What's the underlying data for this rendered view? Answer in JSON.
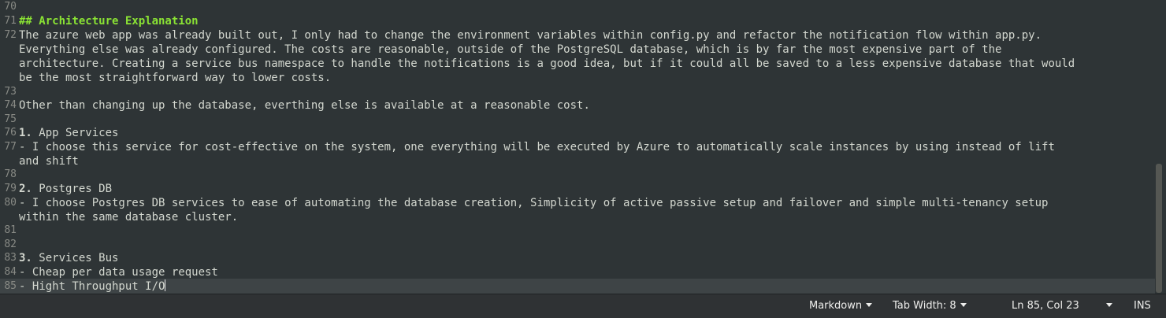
{
  "editor": {
    "lines": [
      {
        "num": "70",
        "text": ""
      },
      {
        "num": "71",
        "text": "## Architecture Explanation"
      },
      {
        "num": "72",
        "text": "The azure web app was already built out, I only had to change the environment variables within config.py and refactor the notification flow within app.py.",
        "wraps": [
          "Everything else was already configured. The costs are reasonable, outside of the PostgreSQL database, which is by far the most expensive part of the",
          "architecture. Creating a service bus namespace to handle the notifications is a good idea, but if it could all be saved to a less expensive database that would",
          "be the most straightforward way to lower costs."
        ]
      },
      {
        "num": "73",
        "text": ""
      },
      {
        "num": "74",
        "text": "Other than changing up the database, everthing else is available at a reasonable cost."
      },
      {
        "num": "75",
        "text": ""
      },
      {
        "num": "76",
        "text_bold": "1.",
        "text": " App Services"
      },
      {
        "num": "77",
        "text": "- I choose this service for cost-effective on the system, one everything will be executed by Azure to automatically scale instances by using instead of lift",
        "wraps": [
          "and shift"
        ]
      },
      {
        "num": "78",
        "text": ""
      },
      {
        "num": "79",
        "text_bold": "2.",
        "text": " Postgres DB"
      },
      {
        "num": "80",
        "text": "- I choose Postgres DB services to ease of automating the database creation, Simplicity of active passive setup and failover and simple multi-tenancy setup",
        "wraps": [
          "within the same database cluster."
        ]
      },
      {
        "num": "81",
        "text": ""
      },
      {
        "num": "82",
        "text": ""
      },
      {
        "num": "83",
        "text_bold": "3.",
        "text": " Services Bus"
      },
      {
        "num": "84",
        "text": "- Cheap per data usage request"
      },
      {
        "num": "85",
        "text": "- Hight Throughput I/O"
      }
    ]
  },
  "statusbar": {
    "language": "Markdown",
    "tab_width": "Tab Width: 8",
    "position": "Ln 85, Col 23",
    "mode": "INS"
  },
  "colors": {
    "background": "#2e3436",
    "heading": "#8ae234",
    "text": "#d3d7cf",
    "gutter": "#888a85"
  }
}
